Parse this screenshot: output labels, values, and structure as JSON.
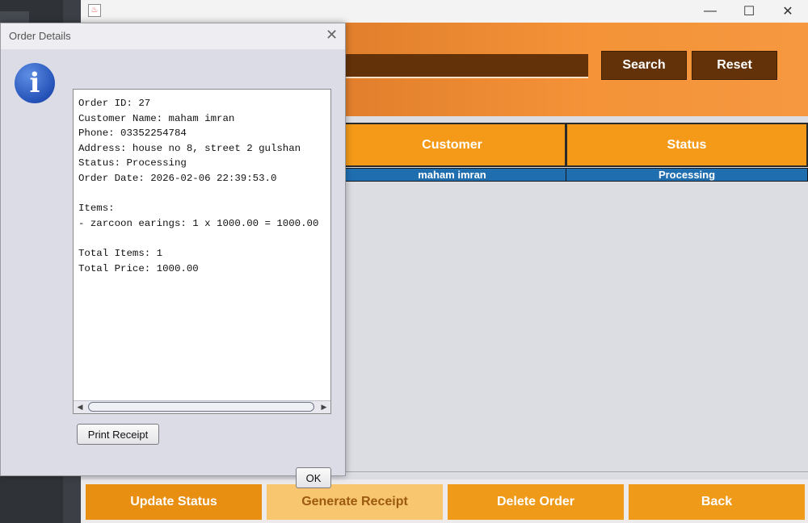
{
  "dialog": {
    "title": "Order Details",
    "close_glyph": "✕",
    "icon": "info-icon",
    "icon_glyph": "i",
    "text_lines": [
      "Order ID: 27",
      "Customer Name: maham imran",
      "Phone: 03352254784",
      "Address: house no 8, street 2 gulshan",
      "Status: Processing",
      "Order Date: 2026-02-06 22:39:53.0",
      "",
      "Items:",
      "- zarcoon earings: 1 x 1000.00 = 1000.00",
      "",
      "Total Items: 1",
      "Total Price: 1000.00"
    ],
    "print_button": "Print Receipt",
    "ok_button": "OK"
  },
  "window": {
    "controls": {
      "minimize": "—",
      "maximize": "☐",
      "close": "✕"
    },
    "java_icon": "java-icon"
  },
  "toolbar": {
    "search_button": "Search",
    "reset_button": "Reset",
    "search_value": ""
  },
  "table": {
    "headers": [
      "Customer",
      "Status"
    ],
    "rows": [
      {
        "customer": "maham imran",
        "status": "Processing"
      }
    ]
  },
  "actions": {
    "update_status": "Update Status",
    "generate_receipt": "Generate Receipt",
    "delete_order": "Delete Order",
    "back": "Back"
  },
  "colors": {
    "accent_orange": "#f49a18",
    "dark_brown": "#633208",
    "selected_row": "#1f6eb0",
    "info_blue": "#2552b8"
  }
}
